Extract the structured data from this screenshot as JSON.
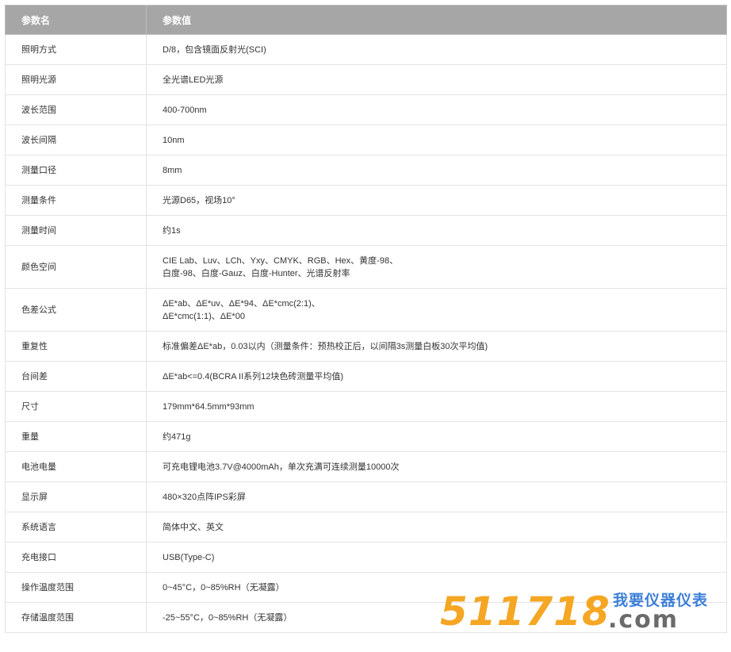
{
  "table": {
    "headers": [
      "参数名",
      "参数值"
    ],
    "rows": [
      {
        "name": "照明方式",
        "value": [
          "D/8，包含镜面反射光(SCI)"
        ]
      },
      {
        "name": "照明光源",
        "value": [
          "全光谱LED光源"
        ]
      },
      {
        "name": "波长范围",
        "value": [
          "400-700nm"
        ]
      },
      {
        "name": "波长间隔",
        "value": [
          "10nm"
        ]
      },
      {
        "name": "测量口径",
        "value": [
          "8mm"
        ]
      },
      {
        "name": "测量条件",
        "value": [
          "光源D65，视场10°"
        ]
      },
      {
        "name": "测量时间",
        "value": [
          "约1s"
        ]
      },
      {
        "name": "颜色空间",
        "value": [
          "CIE Lab、Luv、LCh、Yxy、CMYK、RGB、Hex、黄度-98、",
          "白度-98、白度-Gauz、白度-Hunter、光谱反射率"
        ]
      },
      {
        "name": "色差公式",
        "value": [
          "ΔE*ab、ΔE*uv、ΔE*94、ΔE*cmc(2:1)、",
          "ΔE*cmc(1:1)、ΔE*00"
        ]
      },
      {
        "name": "重复性",
        "value": [
          "标准偏差ΔE*ab，0.03以内（测量条件：预热校正后，以间隔3s测量白板30次平均值)"
        ]
      },
      {
        "name": "台间差",
        "value": [
          "ΔE*ab<=0.4(BCRA II系列12块色砖测量平均值)"
        ]
      },
      {
        "name": "尺寸",
        "value": [
          "179mm*64.5mm*93mm"
        ]
      },
      {
        "name": "重量",
        "value": [
          "约471g"
        ]
      },
      {
        "name": "电池电量",
        "value": [
          "可充电锂电池3.7V@4000mAh，单次充满可连续测量10000次"
        ]
      },
      {
        "name": "显示屏",
        "value": [
          "480×320点阵IPS彩屏"
        ]
      },
      {
        "name": "系统语言",
        "value": [
          "简体中文、英文"
        ]
      },
      {
        "name": "充电接口",
        "value": [
          "USB(Type-C)"
        ]
      },
      {
        "name": "操作温度范围",
        "value": [
          "0~45°C，0~85%RH（无凝露）"
        ]
      },
      {
        "name": "存储温度范围",
        "value": [
          "-25~55°C，0~85%RH（无凝露）"
        ]
      }
    ]
  },
  "watermark": {
    "number": "511718",
    "cn_text": "我要仪器仪表",
    "domain": ".com",
    "colors": {
      "number": "#f5a623",
      "cn": "#3d7fd8",
      "domain": "#6b6b6b"
    }
  }
}
